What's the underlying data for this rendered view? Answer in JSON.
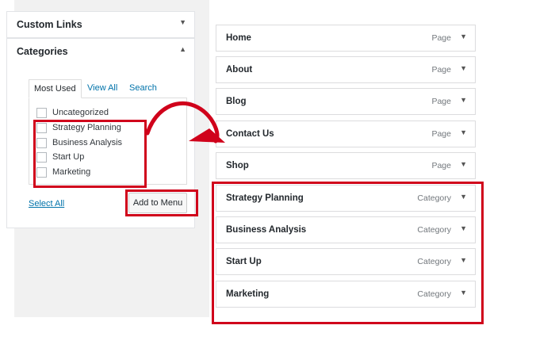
{
  "left_panel": {
    "custom_links": {
      "title": "Custom Links",
      "arrow": "▼"
    },
    "categories": {
      "title": "Categories",
      "arrow": "▲",
      "tabs": [
        {
          "label": "Most Used"
        },
        {
          "label": "View All"
        },
        {
          "label": "Search"
        }
      ],
      "items": [
        {
          "label": "Uncategorized"
        },
        {
          "label": "Strategy Planning"
        },
        {
          "label": "Business Analysis"
        },
        {
          "label": "Start Up"
        },
        {
          "label": "Marketing"
        }
      ],
      "select_all": "Select All",
      "add_button": "Add to Menu"
    }
  },
  "menu_items": [
    {
      "title": "Home",
      "type": "Page",
      "arrow": "▼"
    },
    {
      "title": "About",
      "type": "Page",
      "arrow": "▼"
    },
    {
      "title": "Blog",
      "type": "Page",
      "arrow": "▼"
    },
    {
      "title": "Contact Us",
      "type": "Page",
      "arrow": "▼"
    },
    {
      "title": "Shop",
      "type": "Page",
      "arrow": "▼"
    },
    {
      "title": "Strategy Planning",
      "type": "Category",
      "arrow": "▼"
    },
    {
      "title": "Business Analysis",
      "type": "Category",
      "arrow": "▼"
    },
    {
      "title": "Start Up",
      "type": "Category",
      "arrow": "▼"
    },
    {
      "title": "Marketing",
      "type": "Category",
      "arrow": "▼"
    }
  ],
  "colors": {
    "highlight": "#d0021b",
    "link": "#0073aa",
    "panel_bg": "#f1f1f1"
  }
}
